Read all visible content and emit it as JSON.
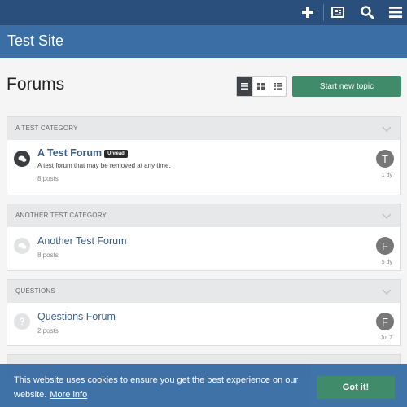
{
  "topbar": {
    "icons": [
      "plus-icon",
      "newspaper-icon",
      "search-icon",
      "menu-icon"
    ]
  },
  "header": {
    "site_title": "Test Site"
  },
  "page": {
    "title": "Forums",
    "new_topic_label": "Start new topic",
    "view_modes": [
      "list-view-icon",
      "grid-view-icon",
      "detailed-list-icon"
    ]
  },
  "categories": [
    {
      "title": "A TEST CATEGORY",
      "forum": {
        "title": "A Test Forum",
        "badge": "Unread",
        "description": "A test forum that may be removed at any time.",
        "posts": "8 posts",
        "avatar_letter": "T",
        "last_time": "1 dy"
      }
    },
    {
      "title": "ANOTHER TEST CATEGORY",
      "forum": {
        "title": "Another Test Forum",
        "posts": "8 posts",
        "avatar_letter": "F",
        "last_time": "5 dy"
      }
    },
    {
      "title": "QUESTIONS",
      "forum": {
        "title": "Questions Forum",
        "posts": "2 posts",
        "avatar_letter": "F",
        "last_time": "Jul 7"
      }
    }
  ],
  "cookie": {
    "message": "This website uses cookies to ensure you get the best experience on our website.",
    "more_info": "More info",
    "button": "Got it!"
  },
  "colors": {
    "topbar": "#2b4f7c",
    "header": "#3a6ea5",
    "accent_green": "#3f8b6a",
    "link": "#3a5f8a"
  }
}
